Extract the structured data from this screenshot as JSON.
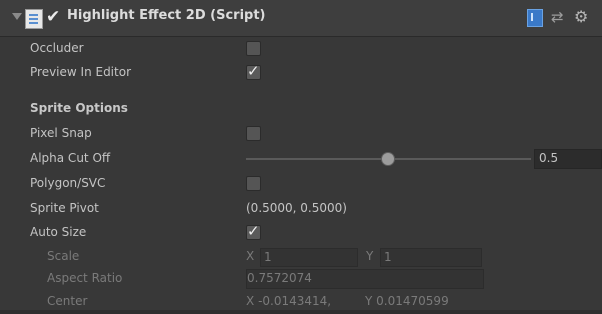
{
  "component": {
    "title": "Highlight Effect 2D (Script)",
    "icons": {
      "fold": "foldout-arrow-icon",
      "script": "script-icon",
      "enabled": "checkmark-icon",
      "help": "help-book-icon",
      "presets": "presets-icon",
      "settings": "gear-icon"
    }
  },
  "fields": {
    "occluder": {
      "label": "Occluder",
      "checked": false
    },
    "preview_in_editor": {
      "label": "Preview In Editor",
      "checked": true
    },
    "sprite_options": {
      "label": "Sprite Options"
    },
    "pixel_snap": {
      "label": "Pixel Snap",
      "checked": false
    },
    "alpha_cut_off": {
      "label": "Alpha Cut Off",
      "value": "0.5",
      "fraction": 0.5
    },
    "polygon_svc": {
      "label": "Polygon/SVC",
      "checked": false
    },
    "sprite_pivot": {
      "label": "Sprite Pivot",
      "value": "(0.5000, 0.5000)"
    },
    "auto_size": {
      "label": "Auto Size",
      "checked": true
    },
    "scale": {
      "label": "Scale",
      "x_label": "X",
      "x": "1",
      "y_label": "Y",
      "y": "1"
    },
    "aspect_ratio": {
      "label": "Aspect Ratio",
      "value": "0.7572074"
    },
    "center": {
      "label": "Center",
      "x_label": "X",
      "x": "-0.0143414",
      "y_label": "Y",
      "y": "0.01470599"
    }
  }
}
